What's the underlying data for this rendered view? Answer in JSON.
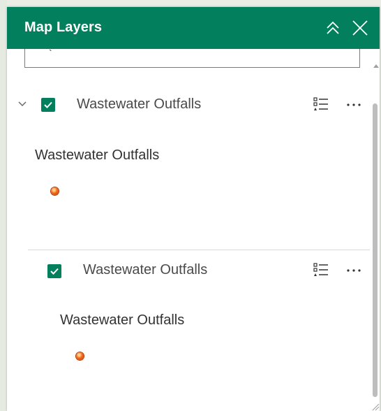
{
  "header": {
    "title": "Map Layers"
  },
  "search": {
    "value": "`"
  },
  "layers": [
    {
      "title": "Wastewater Outfalls",
      "checked": true,
      "legend_label": "Wastewater Outfalls"
    },
    {
      "title": "Wastewater Outfalls",
      "checked": true,
      "legend_label": "Wastewater Outfalls"
    }
  ],
  "colors": {
    "header_bg": "#027f5c",
    "checkbox": "#027f5c",
    "symbol": "#f26a1b"
  },
  "icons": {
    "collapse": "double-chevron-up-icon",
    "close": "close-icon",
    "expand": "chevron-down-icon",
    "legend": "legend-list-icon",
    "more": "more-horizontal-icon"
  }
}
